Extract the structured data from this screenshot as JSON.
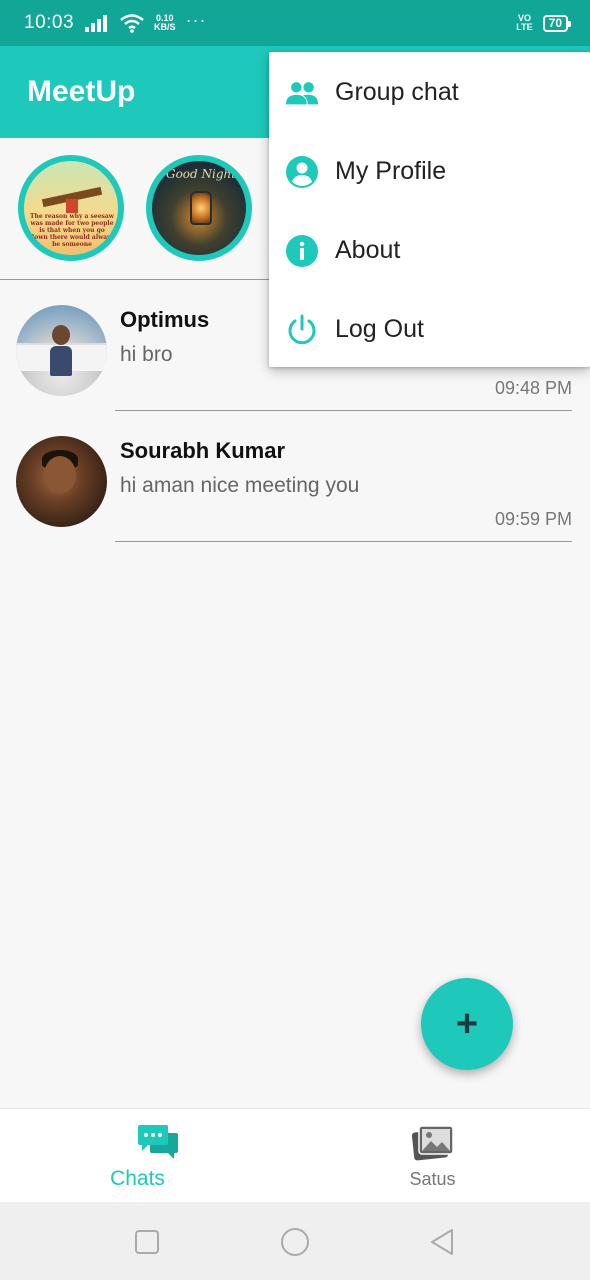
{
  "status_bar": {
    "time": "10:03",
    "speed_value": "0.10",
    "speed_unit": "KB/S",
    "more": "···",
    "network_top": "VO",
    "network_bottom": "LTE",
    "battery": "70"
  },
  "app_bar": {
    "title": "MeetUp"
  },
  "stories": [
    {
      "quote": "The reason why a seesaw was made for two people is that when you go down there would always be someone"
    },
    {
      "caption": "Good Night"
    }
  ],
  "chats": [
    {
      "name": "Optimus",
      "message": "hi bro",
      "time": "09:48 PM"
    },
    {
      "name": "Sourabh Kumar",
      "message": "hi aman nice meeting you",
      "time": "09:59 PM"
    }
  ],
  "menu": {
    "items": [
      {
        "label": "Group chat",
        "icon": "group-icon"
      },
      {
        "label": "My Profile",
        "icon": "profile-icon"
      },
      {
        "label": "About",
        "icon": "info-icon"
      },
      {
        "label": "Log Out",
        "icon": "power-icon"
      }
    ]
  },
  "fab": {
    "icon": "plus-icon",
    "label": "+"
  },
  "bottom_nav": {
    "tabs": [
      {
        "label": "Chats",
        "icon": "chat-bubbles-icon",
        "active": true
      },
      {
        "label": "Satus",
        "icon": "gallery-icon",
        "active": false
      }
    ]
  },
  "colors": {
    "accent": "#1ec9bb",
    "status_bar": "#12a697",
    "background": "#f7f7f7"
  }
}
